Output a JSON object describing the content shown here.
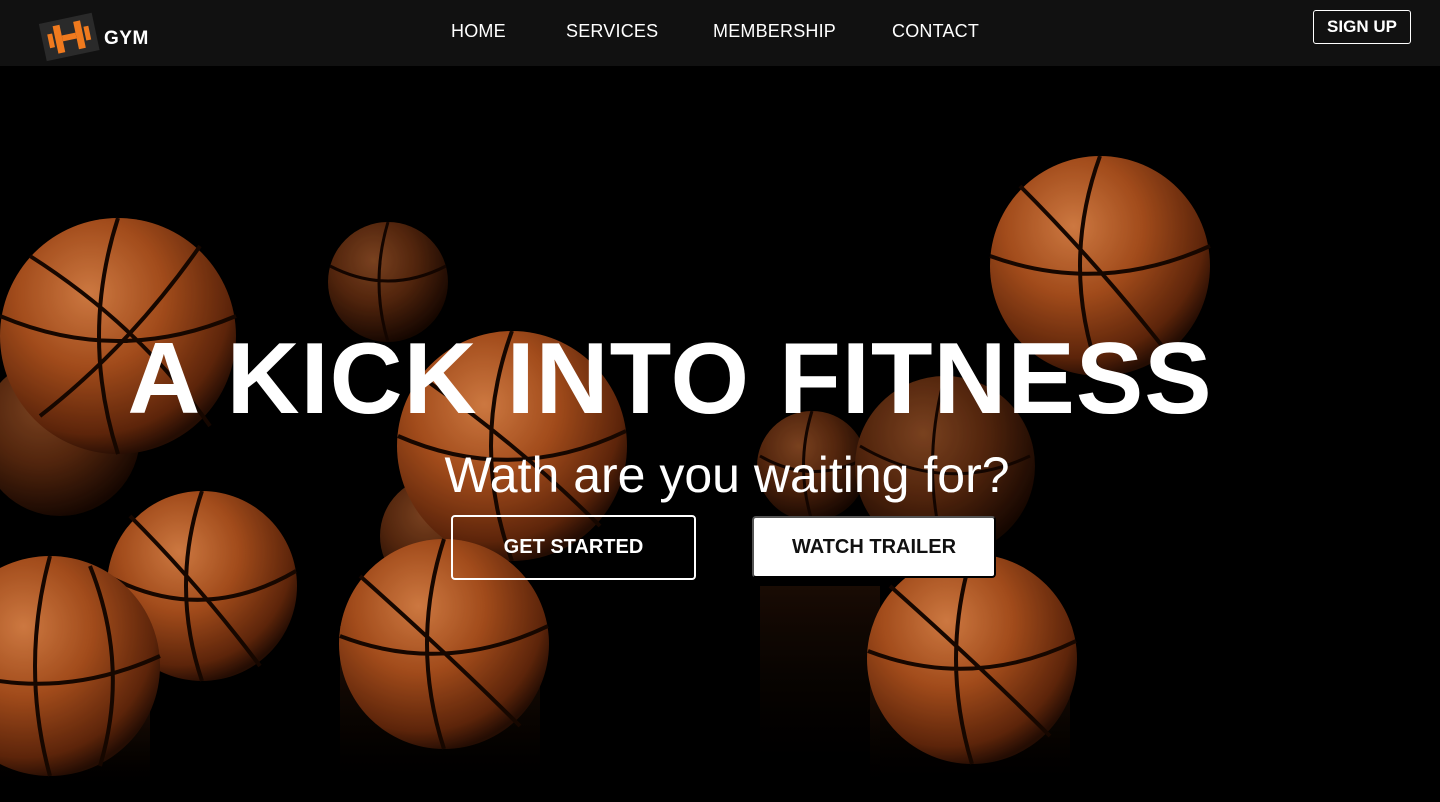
{
  "brand": {
    "name": "GYM",
    "logo_icon": "dumbbell-logo-icon",
    "accent_color": "#F07A1E"
  },
  "nav": {
    "links": [
      {
        "label": "HOME"
      },
      {
        "label": "SERVICES"
      },
      {
        "label": "MEMBERSHIP"
      },
      {
        "label": "CONTACT"
      }
    ],
    "signup_label": "SIGN UP"
  },
  "hero": {
    "title": "A KICK INTO FITNESS",
    "subtitle": "Wath are you waiting for?",
    "primary_button": "GET STARTED",
    "secondary_button": "WATCH TRAILER",
    "background_image": "basketballs-falling-on-black-background"
  }
}
